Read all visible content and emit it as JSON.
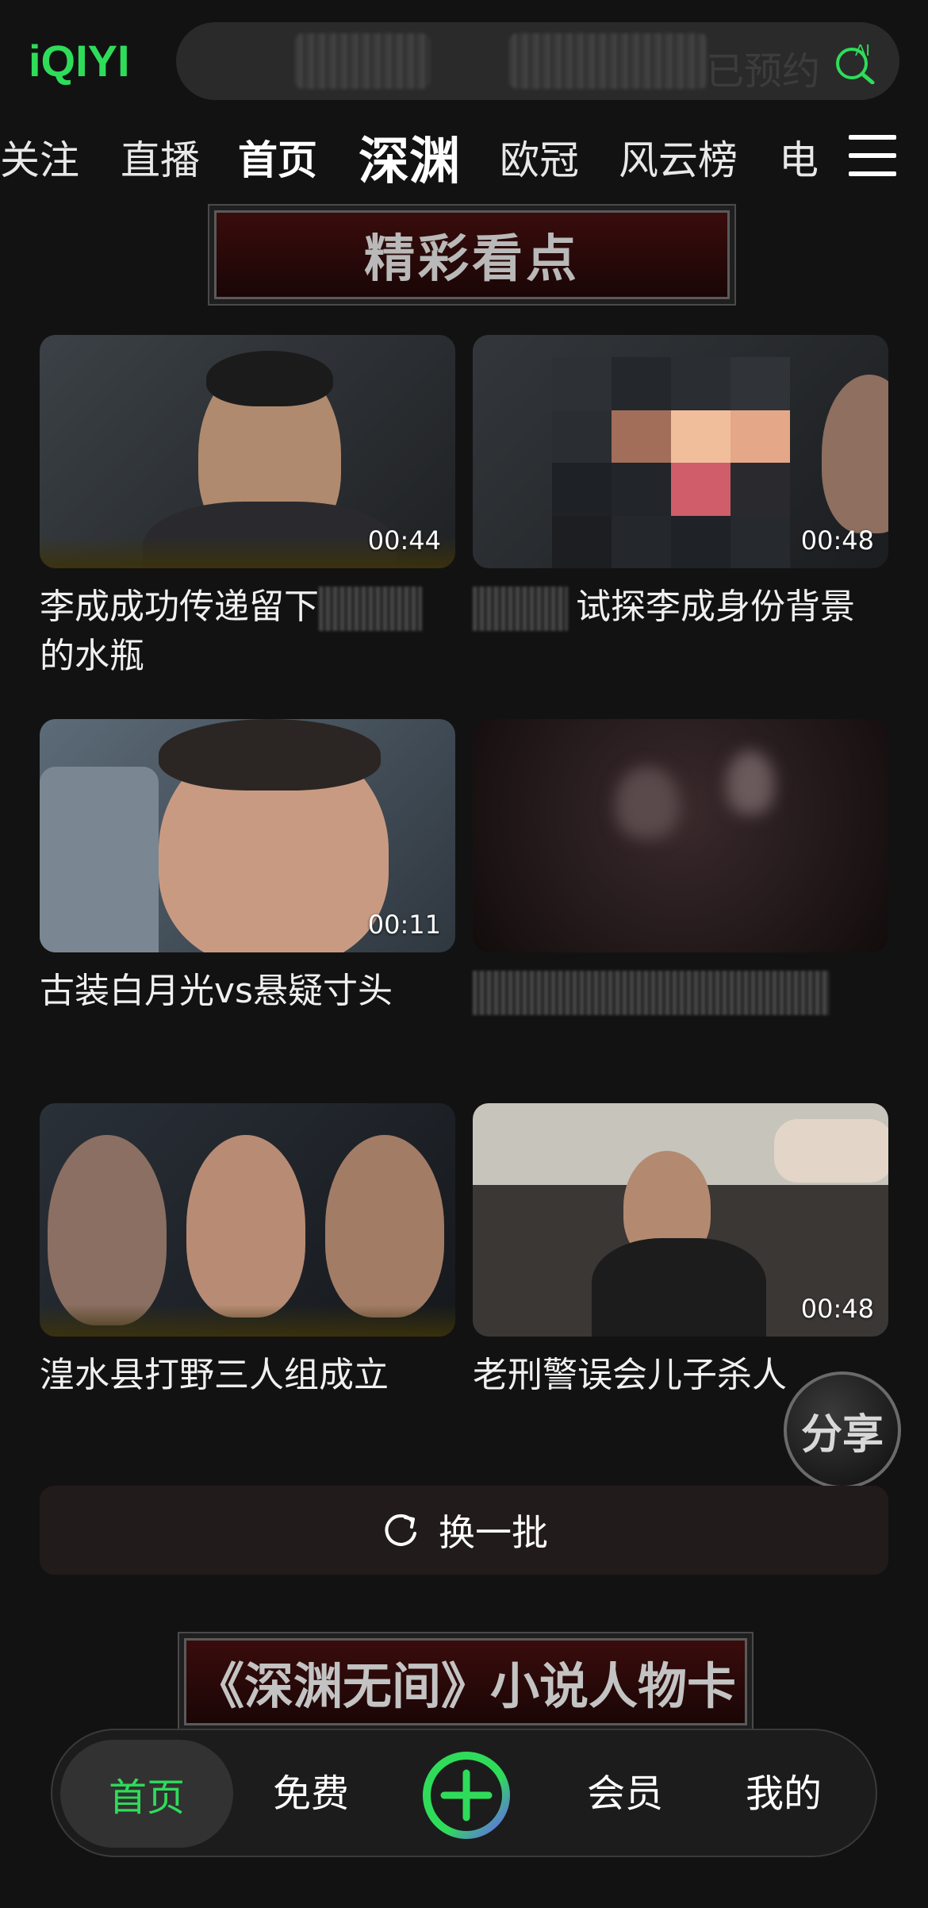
{
  "header": {
    "logo": "iQIYI",
    "search_hint": "已预约",
    "ai_icon": "AI"
  },
  "tabs": [
    {
      "label": "关注"
    },
    {
      "label": "直播"
    },
    {
      "label": "首页"
    },
    {
      "label": "深渊"
    },
    {
      "label": "欧冠"
    },
    {
      "label": "风云榜"
    },
    {
      "label": "电"
    }
  ],
  "section": {
    "banner_title": "精彩看点"
  },
  "videos": [
    {
      "title_a": "李成成功传递留下",
      "title_b": "的水瓶",
      "duration": "00:44"
    },
    {
      "title": "试探李成身份背景",
      "duration": "00:48"
    },
    {
      "title": "古装白月光vs悬疑寸头",
      "duration": "00:11"
    },
    {
      "title": "",
      "duration": ""
    },
    {
      "title": "湟水县打野三人组成立",
      "duration": ""
    },
    {
      "title": "老刑警误会儿子杀人",
      "duration": "00:48"
    }
  ],
  "share_label": "分享",
  "refresh_label": "换一批",
  "next_banner": "《深渊无间》小说人物卡",
  "bottom_nav": {
    "home": "首页",
    "free": "免费",
    "vip": "会员",
    "mine": "我的"
  },
  "colors": {
    "brand_green": "#2fdc5a",
    "background": "#121212"
  }
}
